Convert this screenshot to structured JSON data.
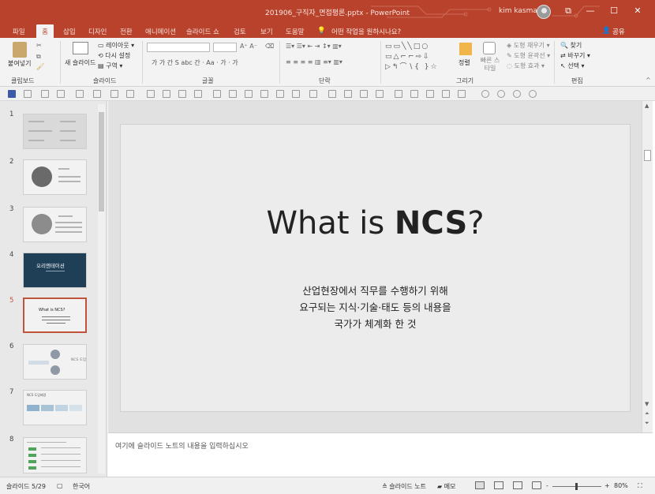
{
  "window": {
    "document_title": "201906_구직자_면접평론.pptx - PowerPoint",
    "user_name": "kim kasman",
    "min_glyph": "—",
    "max_glyph": "☐",
    "close_glyph": "✕",
    "restore_glyph": "⧉"
  },
  "tabs": [
    {
      "label": "파일"
    },
    {
      "label": "홈"
    },
    {
      "label": "삽입"
    },
    {
      "label": "디자인"
    },
    {
      "label": "전환"
    },
    {
      "label": "애니메이션"
    },
    {
      "label": "슬라이드 쇼"
    },
    {
      "label": "검토"
    },
    {
      "label": "보기"
    },
    {
      "label": "도움말"
    }
  ],
  "tell_me": "어떤 작업을 원하시나요?",
  "share_label": "공유",
  "ribbon": {
    "clipboard": {
      "paste": "붙여넣기",
      "group": "클립보드"
    },
    "slides": {
      "new_slide": "새 슬라이드",
      "layout": "레이아웃",
      "reset": "다시 설정",
      "section": "구역",
      "group": "슬라이드"
    },
    "font": {
      "group": "글꼴",
      "row2": "가 가 간 S abc 간 · Aa · 가 · 가"
    },
    "paragraph": {
      "group": "단락"
    },
    "drawing": {
      "arrange": "정렬",
      "quick_styles": "빠른 스타일",
      "fill": "도형 채우기",
      "outline": "도형 윤곽선",
      "effects": "도형 효과",
      "group": "그리기"
    },
    "editing": {
      "find": "찾기",
      "replace": "바꾸기",
      "select": "선택",
      "group": "편집"
    }
  },
  "thumbnails": [
    {
      "num": "1",
      "selected": false
    },
    {
      "num": "2",
      "selected": false
    },
    {
      "num": "3",
      "selected": false
    },
    {
      "num": "4",
      "selected": false,
      "title": "오리엔테이션"
    },
    {
      "num": "5",
      "selected": true,
      "title": "What is NCS?"
    },
    {
      "num": "6",
      "selected": false,
      "title": "NCS 도입"
    },
    {
      "num": "7",
      "selected": false,
      "title": "NCS 도입배경"
    },
    {
      "num": "8",
      "selected": false
    }
  ],
  "slide": {
    "title_prefix": "What is ",
    "title_bold": "NCS",
    "title_suffix": "?",
    "body_lines": [
      "산업현장에서 직무를 수행하기 위해",
      "요구되는 지식·기술·태도 등의 내용을",
      "국가가 체계화 한 것"
    ]
  },
  "notes_placeholder": "여기에 슬라이드 노트의 내용을 입력하십시오",
  "status": {
    "slide_count": "슬라이드 5/29",
    "language": "한국어",
    "notes": "슬라이드 노트",
    "comments": "메모",
    "zoom": "80%",
    "zoom_minus": "-",
    "zoom_plus": "+"
  },
  "colors": {
    "accent": "#b8422c",
    "selected_thumb": "#c0533b"
  }
}
